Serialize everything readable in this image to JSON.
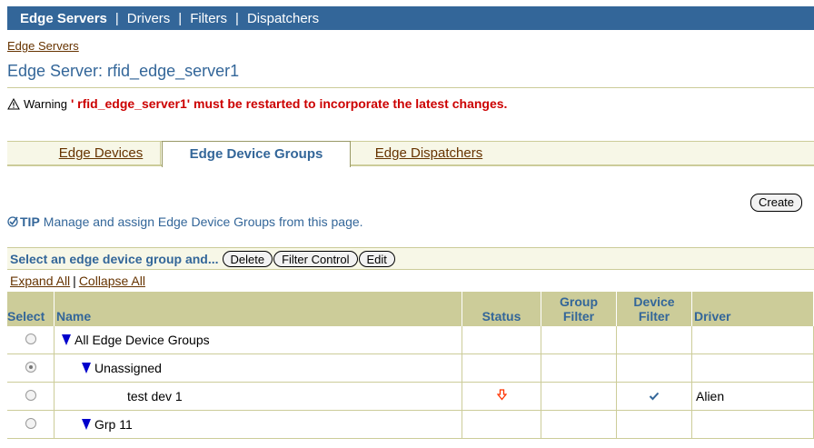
{
  "nav": {
    "items": [
      "Edge Servers",
      "Drivers",
      "Filters",
      "Dispatchers"
    ],
    "separator": "|"
  },
  "breadcrumb": "Edge Servers",
  "page_title": "Edge Server: rfid_edge_server1",
  "warning": {
    "label": "Warning",
    "message": "' rfid_edge_server1' must be restarted to incorporate the latest changes."
  },
  "tabs": [
    "Edge Devices",
    "Edge Device Groups",
    "Edge Dispatchers"
  ],
  "active_tab": "Edge Device Groups",
  "create_label": "Create",
  "tip": {
    "label": "TIP",
    "text": "Manage and assign Edge Device Groups from this page."
  },
  "table": {
    "select_label": "Select an edge device group and...",
    "actions": [
      "Delete",
      "Filter Control",
      "Edit"
    ],
    "expand_all": "Expand All",
    "collapse_all": "Collapse All",
    "columns": [
      "Select",
      "Name",
      "Status",
      "Group Filter",
      "Device Filter",
      "Driver"
    ],
    "rows": [
      {
        "name": "All Edge Device Groups",
        "indent": 0,
        "expandable": true,
        "selected": false,
        "status": "",
        "device_filter": "",
        "driver": ""
      },
      {
        "name": "Unassigned",
        "indent": 1,
        "expandable": true,
        "selected": true,
        "status": "",
        "device_filter": "",
        "driver": ""
      },
      {
        "name": "test dev 1",
        "indent": 3,
        "expandable": false,
        "selected": false,
        "status": "down-arrow-icon",
        "device_filter": "check-icon",
        "driver": "Alien"
      },
      {
        "name": "Grp 11",
        "indent": 1,
        "expandable": true,
        "selected": false,
        "status": "",
        "device_filter": "",
        "driver": ""
      }
    ]
  },
  "colors": {
    "nav_bg": "#336699",
    "header_bg": "#cccc99",
    "warning_text": "#cc0000",
    "link": "#663300",
    "title": "#336699"
  }
}
